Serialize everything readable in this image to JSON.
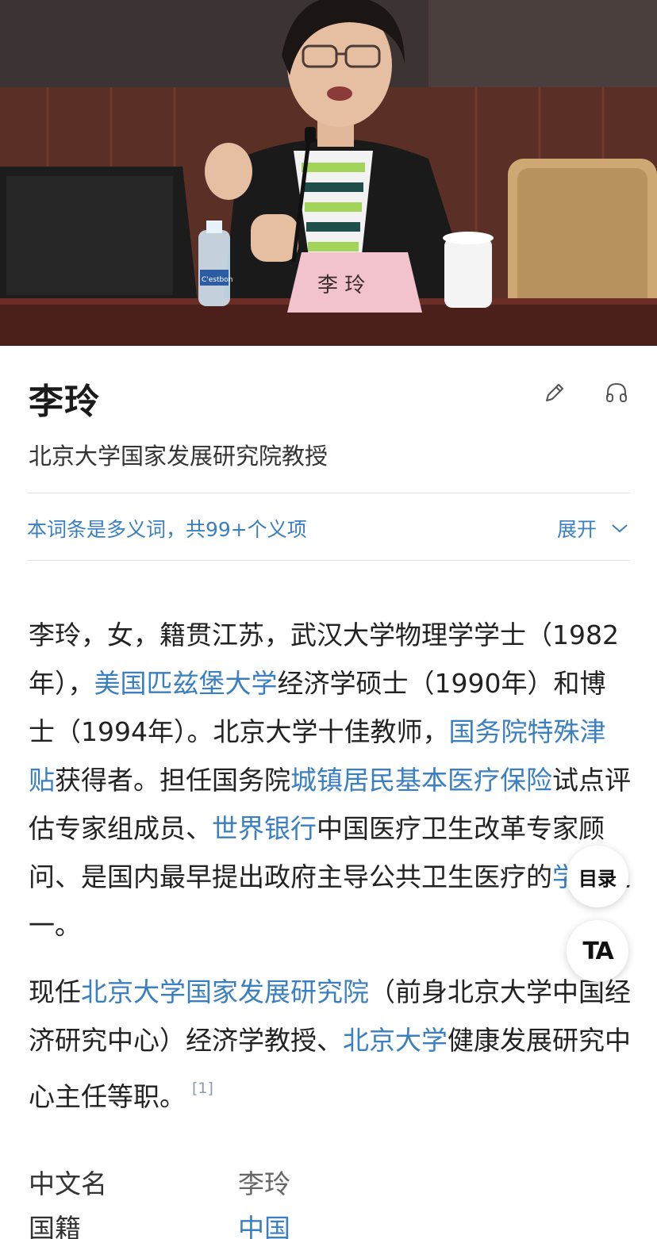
{
  "hero": {
    "nameplate_text": "李 玲",
    "bottle_label": "C'estbon"
  },
  "header": {
    "title": "李玲",
    "subtitle": "北京大学国家发展研究院教授",
    "edit_icon": "pencil-icon",
    "listen_icon": "headphones-icon"
  },
  "polysemy": {
    "text": "本词条是多义词，共99+个义项",
    "expand_label": "展开"
  },
  "article": {
    "p1": [
      {
        "t": "李玲，女，籍贯江苏，武汉大学物理学学士（1982年），"
      },
      {
        "t": "美国匹兹堡大学",
        "link": true
      },
      {
        "t": "经济学硕士（1990年）和博士（1994年）。北京大学十佳教师，"
      },
      {
        "t": "国务院特殊津贴",
        "link": true
      },
      {
        "t": "获得者。担任国务院"
      },
      {
        "t": "城镇居民基本医疗保险",
        "link": true
      },
      {
        "t": "试点评估专家组成员、"
      },
      {
        "t": "世界银行",
        "link": true
      },
      {
        "t": "中国医疗卫生改革专家顾问、是国内最早提出政府主导公共卫生医疗的"
      },
      {
        "t": "学者",
        "link": true
      },
      {
        "t": "之一。"
      }
    ],
    "p2": [
      {
        "t": "现任"
      },
      {
        "t": "北京大学国家发展研究院",
        "link": true
      },
      {
        "t": "（前身北京大学中国经济研究中心）经济学教授、"
      },
      {
        "t": "北京大学",
        "link": true
      },
      {
        "t": "健康发展研究中心主任等职。"
      }
    ],
    "p2_ref": "[1]"
  },
  "info": [
    {
      "key": "中文名",
      "value": "李玲",
      "link": false
    },
    {
      "key": "国籍",
      "value": "中国",
      "link": true
    }
  ],
  "fabs": {
    "toc_label": "目录",
    "text_size_label": "TA"
  },
  "colors": {
    "link": "#3a7fc1",
    "nameplate": "#f2c3cd"
  }
}
